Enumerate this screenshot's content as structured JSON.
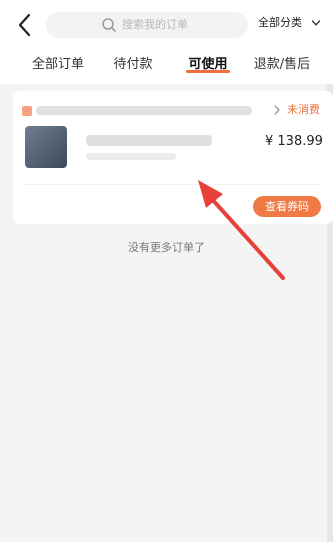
{
  "header": {
    "search_placeholder": "搜索我的订单",
    "category_label": "全部分类"
  },
  "tabs": [
    {
      "label": "全部订单"
    },
    {
      "label": "待付款"
    },
    {
      "label": "可使用",
      "active": true
    },
    {
      "label": "退款/售后"
    }
  ],
  "order": {
    "status": "未消费",
    "price": "¥ 138.99",
    "action_label": "查看券码"
  },
  "footer": {
    "no_more_text": "没有更多订单了"
  },
  "colors": {
    "accent": "#ef7a45",
    "annotation": "#e8413a"
  },
  "icons": {
    "back": "chevron-left-icon",
    "search": "search-icon",
    "dropdown": "chevron-down-icon"
  }
}
